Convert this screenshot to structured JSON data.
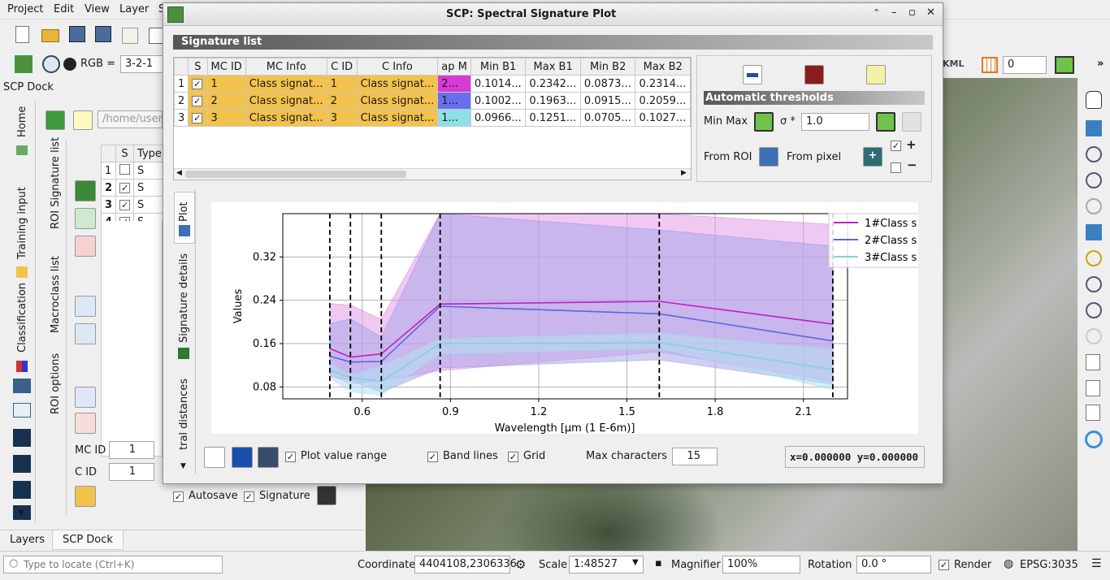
{
  "menu": [
    "Project",
    "Edit",
    "View",
    "Layer",
    "S"
  ],
  "toolbar": {
    "rgb_label": "RGB =",
    "rgb_value": "3-2-1",
    "num": "0",
    "kml": "KML"
  },
  "dock": {
    "title": "SCP Dock",
    "vtabs": [
      "Home",
      "Training input",
      "Classification"
    ],
    "vtabs2": [
      "ROI Signature list",
      "Macroclass list",
      "ROI options"
    ],
    "path": "/home/user/D",
    "table_headers": [
      "S",
      "Type"
    ],
    "rows": [
      {
        "n": "1",
        "checked": false,
        "t": "S"
      },
      {
        "n": "2",
        "checked": true,
        "t": "S"
      },
      {
        "n": "3",
        "checked": true,
        "t": "S"
      },
      {
        "n": "4",
        "checked": true,
        "t": "S"
      }
    ],
    "mcid_label": "MC ID",
    "mcid": "1",
    "cid_label": "C ID",
    "cid": "1",
    "autosave": "Autosave",
    "signature": "Signature",
    "bottom_tabs": [
      "Layers",
      "SCP Dock"
    ]
  },
  "win": {
    "title": "SCP: Spectral Signature Plot",
    "siglist": "Signature list",
    "cols": [
      "S",
      "MC ID",
      "MC Info",
      "C ID",
      "C Info",
      "ap M",
      "Min B1",
      "Max B1",
      "Min B2",
      "Max B2"
    ],
    "rows": [
      {
        "n": "1",
        "mcid": "1",
        "mcinfo": "Class signat...",
        "cid": "1",
        "cinfo": "Class signat...",
        "color": "#d63bd6",
        "cval": "2...",
        "minb1": "0.1014...",
        "maxb1": "0.2342...",
        "minb2": "0.0873...",
        "maxb2": "0.2314..."
      },
      {
        "n": "2",
        "mcid": "2",
        "mcinfo": "Class signat...",
        "cid": "2",
        "cinfo": "Class signat...",
        "color": "#6a6ff0",
        "cval": "1...",
        "minb1": "0.1002...",
        "maxb1": "0.1963...",
        "minb2": "0.0915...",
        "maxb2": "0.2059..."
      },
      {
        "n": "3",
        "mcid": "3",
        "mcinfo": "Class signat...",
        "cid": "3",
        "cinfo": "Class signat...",
        "color": "#8fe0e6",
        "cval": "1...",
        "minb1": "0.0966...",
        "maxb1": "0.1251...",
        "minb2": "0.0705...",
        "maxb2": "0.1027..."
      }
    ],
    "auto": "Automatic  thresholds",
    "minmax": "Min Max",
    "sigma": "σ *",
    "sigma_val": "1.0",
    "from_roi": "From ROI",
    "from_pixel": "From pixel",
    "vtabs": [
      "Plot",
      "Signature details",
      "tral distances"
    ],
    "plot_value_range": "Plot value range",
    "band_lines": "Band lines",
    "grid": "Grid",
    "max_chars_label": "Max characters",
    "max_chars": "15",
    "coords": "x=0.000000 y=0.000000"
  },
  "status": {
    "locate": "Type to locate (Ctrl+K)",
    "coord_label": "Coordinate",
    "coord": "4404108,2306336",
    "scale_label": "Scale",
    "scale": "1:48527",
    "mag_label": "Magnifier",
    "mag": "100%",
    "rot_label": "Rotation",
    "rot": "0.0 °",
    "render": "Render",
    "crs": "EPSG:3035"
  },
  "chart_data": {
    "type": "line",
    "xlabel": "Wavelength [µm (1 E-6m)]",
    "ylabel": "Values",
    "xlim": [
      0.33,
      2.25
    ],
    "ylim": [
      0.058,
      0.4
    ],
    "xticks": [
      "0.6",
      "0.9",
      "1.2",
      "1.5",
      "1.8",
      "2.1"
    ],
    "yticks": [
      "0.08",
      "0.16",
      "0.24",
      "0.32"
    ],
    "band_lines": [
      0.49,
      0.56,
      0.665,
      0.865,
      1.61,
      2.2
    ],
    "grid": true,
    "legend_position": "top-right",
    "series": [
      {
        "name": "1#Class s",
        "color": "#c41cc4",
        "fill": "#e19de6",
        "x": [
          0.49,
          0.56,
          0.665,
          0.865,
          1.61,
          2.2
        ],
        "values": [
          0.151,
          0.135,
          0.141,
          0.233,
          0.238,
          0.196
        ],
        "min": [
          0.102,
          0.086,
          0.091,
          0.11,
          0.145,
          0.09
        ],
        "max": [
          0.234,
          0.231,
          0.205,
          0.4,
          0.4,
          0.38
        ]
      },
      {
        "name": "2#Class s",
        "color": "#5b67e0",
        "fill": "#a9a6ea",
        "x": [
          0.49,
          0.56,
          0.665,
          0.865,
          1.61,
          2.2
        ],
        "values": [
          0.137,
          0.126,
          0.127,
          0.229,
          0.215,
          0.165
        ],
        "min": [
          0.1,
          0.092,
          0.07,
          0.115,
          0.13,
          0.085
        ],
        "max": [
          0.196,
          0.206,
          0.172,
          0.4,
          0.37,
          0.34
        ]
      },
      {
        "name": "3#Class s",
        "color": "#7fd3df",
        "fill": "#b3dff0",
        "x": [
          0.49,
          0.56,
          0.665,
          0.865,
          1.61,
          2.2
        ],
        "values": [
          0.111,
          0.097,
          0.09,
          0.16,
          0.162,
          0.112
        ],
        "min": [
          0.097,
          0.071,
          0.065,
          0.14,
          0.15,
          0.075
        ],
        "max": [
          0.125,
          0.103,
          0.12,
          0.17,
          0.18,
          0.15
        ]
      }
    ]
  }
}
